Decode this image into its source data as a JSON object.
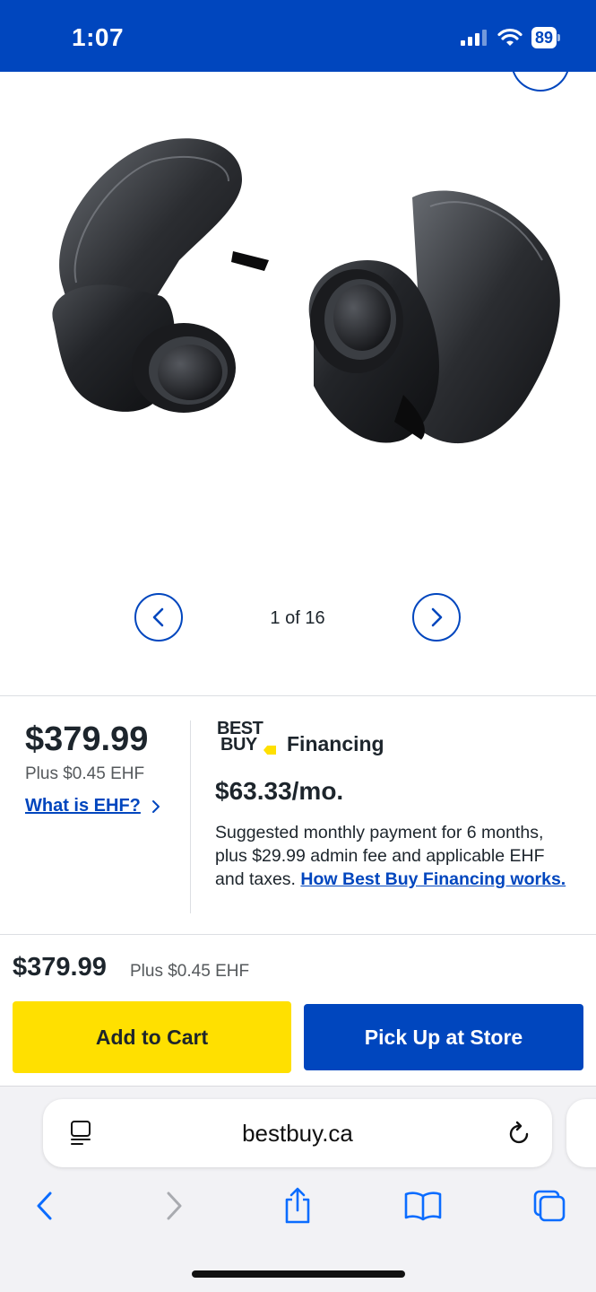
{
  "status_bar": {
    "time": "1:07",
    "battery": "89",
    "bg_color": "#0046be"
  },
  "carousel": {
    "counter": "1 of 16",
    "prev_icon": "chevron-left-icon",
    "next_icon": "chevron-right-icon"
  },
  "pricing": {
    "price": "$379.99",
    "ehf": "Plus $0.45 EHF",
    "ehf_link": "What is EHF?"
  },
  "financing": {
    "logo_line1": "BEST",
    "logo_line2": "BUY",
    "label": "Financing",
    "monthly": "$63.33/mo.",
    "description": "Suggested monthly payment for 6 months, plus $29.99 admin fee and applicable EHF and taxes.",
    "link": "How Best Buy Financing works."
  },
  "cart_bar": {
    "price": "$379.99",
    "ehf": "Plus $0.45 EHF",
    "add_to_cart": "Add to Cart",
    "pickup": "Pick Up at Store",
    "add_color": "#ffe000",
    "pickup_color": "#0046be"
  },
  "browser": {
    "url": "bestbuy.ca"
  }
}
